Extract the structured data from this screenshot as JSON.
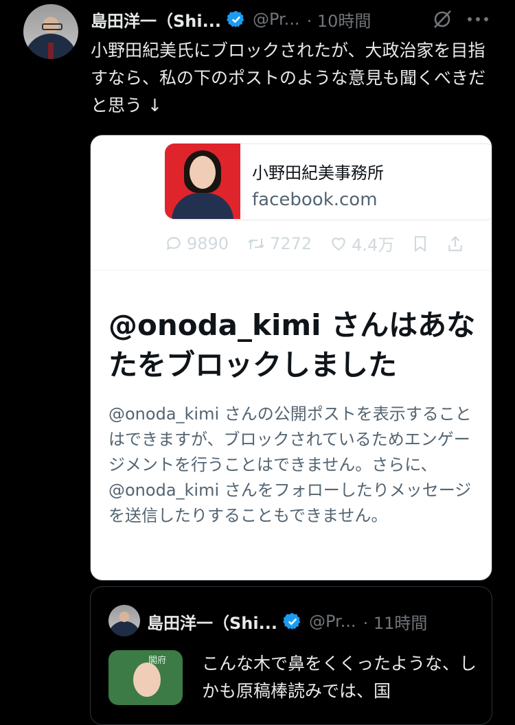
{
  "post": {
    "author_name": "島田洋一（Shi...",
    "handle": "@Pr...",
    "time": "· 10時間",
    "text": "小野田紀美氏にブロックされたが、大政治家を目指すなら、私の下のポストのような意見も聞くべきだと思う ↓",
    "colors": {
      "verified": "#1d9bf0",
      "background": "#000000"
    }
  },
  "screenshot_card": {
    "link_preview": {
      "title": "小野田紀美事務所",
      "domain": "facebook.com"
    },
    "stats": {
      "replies": "9890",
      "reposts": "7272",
      "likes": "4.4万"
    },
    "block_title": "@onoda_kimi さんはあなたをブロックしました",
    "block_description": "@onoda_kimi さんの公開ポストを表示することはできますが、ブロックされているためエンゲージメントを行うことはできません。さらに、@onoda_kimi さんをフォローしたりメッセージを送信したりすることもできません。"
  },
  "quoted_post": {
    "author_name": "島田洋一（Shi...",
    "handle": "@Pr...",
    "time": "· 11時間",
    "text": "こんな木で鼻をくくったような、しかも原稿棒読みでは、国"
  },
  "icons": [
    "grok-icon",
    "more-icon",
    "verified-icon",
    "reply-icon",
    "repost-icon",
    "like-icon",
    "bookmark-icon",
    "share-icon"
  ]
}
